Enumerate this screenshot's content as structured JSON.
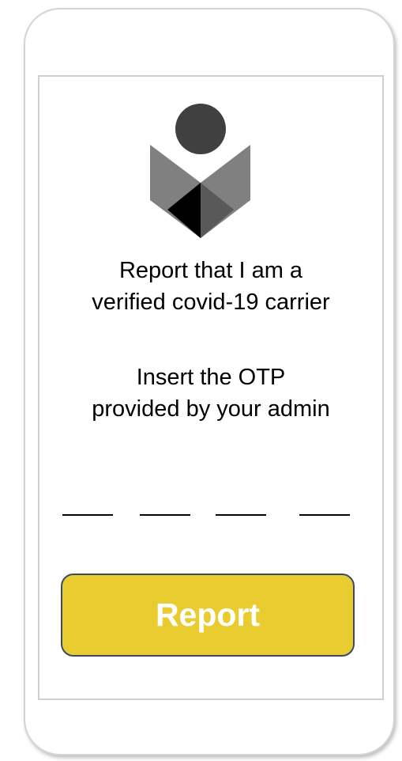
{
  "screen": {
    "title_lines": [
      "Report that I am a",
      "verified covid-19 carrier"
    ],
    "instruction_lines": [
      "Insert the OTP",
      "provided by your admin"
    ],
    "otp_slots": [
      "",
      "",
      "",
      ""
    ],
    "report_button_label": "Report"
  },
  "colors": {
    "button_fill": "#e8cc30",
    "button_border": "#3b4b66",
    "button_text": "#ffffff",
    "logo_head": "#404040",
    "logo_dark": "#000000",
    "logo_mid": "#595959",
    "logo_light": "#808080"
  },
  "icons": {
    "logo": "reader-book-icon"
  }
}
